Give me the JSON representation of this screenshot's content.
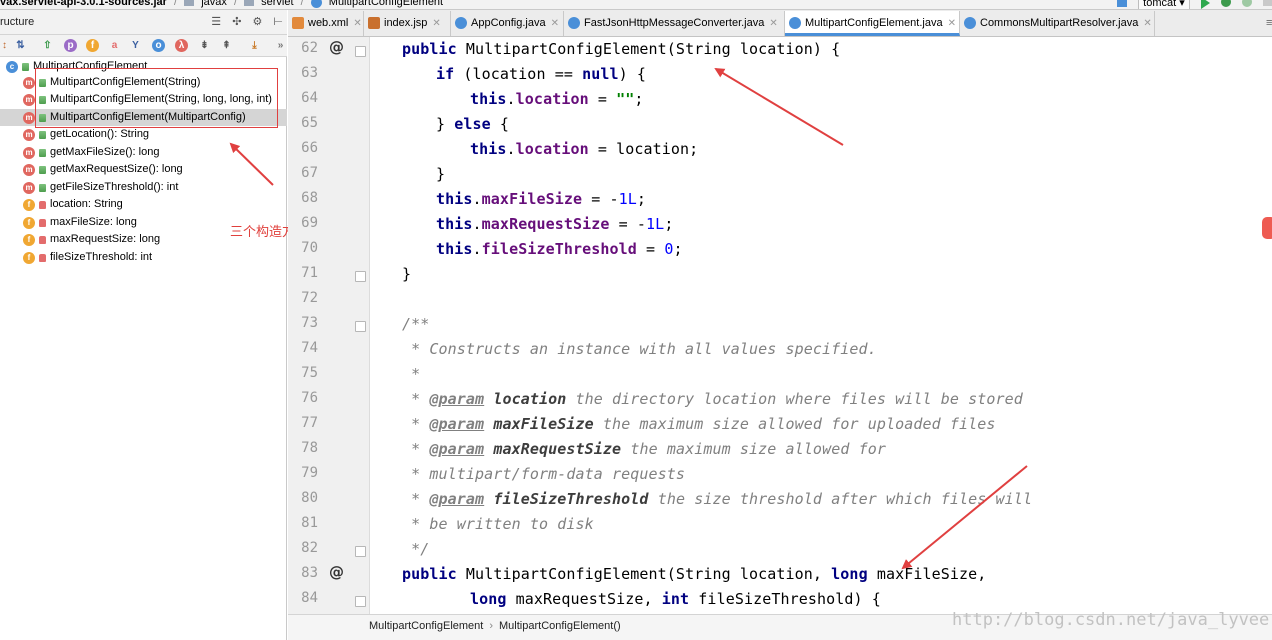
{
  "nav": {
    "crumbs": [
      "vax.servlet-api-3.0.1-sources.jar",
      "javax",
      "servlet",
      "MultipartConfigElement"
    ],
    "run_config": "tomcat"
  },
  "structure": {
    "title": "ructure",
    "root": "MultipartConfigElement",
    "items": [
      {
        "kind": "m",
        "visibility": "public",
        "label": "MultipartConfigElement(String)"
      },
      {
        "kind": "m",
        "visibility": "public",
        "label": "MultipartConfigElement(String, long, long, int)"
      },
      {
        "kind": "m",
        "visibility": "public",
        "label": "MultipartConfigElement(MultipartConfig)"
      },
      {
        "kind": "m",
        "visibility": "public",
        "label": "getLocation(): String"
      },
      {
        "kind": "m",
        "visibility": "public",
        "label": "getMaxFileSize(): long"
      },
      {
        "kind": "m",
        "visibility": "public",
        "label": "getMaxRequestSize(): long"
      },
      {
        "kind": "m",
        "visibility": "public",
        "label": "getFileSizeThreshold(): int"
      },
      {
        "kind": "f",
        "visibility": "private",
        "label": "location: String"
      },
      {
        "kind": "f",
        "visibility": "private",
        "label": "maxFileSize: long"
      },
      {
        "kind": "f",
        "visibility": "private",
        "label": "maxRequestSize: long"
      },
      {
        "kind": "f",
        "visibility": "private",
        "label": "fileSizeThreshold: int"
      }
    ],
    "annotation": "三个构造方法"
  },
  "tabs": [
    {
      "label": "web.xml",
      "icon": "xml-file-icon"
    },
    {
      "label": "index.jsp",
      "icon": "jsp-file-icon"
    },
    {
      "label": "AppConfig.java",
      "icon": "class-icon"
    },
    {
      "label": "FastJsonHttpMessageConverter.java",
      "icon": "class-icon"
    },
    {
      "label": "MultipartConfigElement.java",
      "icon": "class-icon",
      "active": true
    },
    {
      "label": "CommonsMultipartResolver.java",
      "icon": "class-icon"
    }
  ],
  "code": {
    "line_numbers": [
      "62",
      "63",
      "64",
      "65",
      "66",
      "67",
      "68",
      "69",
      "70",
      "71",
      "72",
      "73",
      "74",
      "75",
      "76",
      "77",
      "78",
      "79",
      "80",
      "81",
      "82",
      "83",
      "84"
    ],
    "at_marks": [
      "@",
      "@"
    ],
    "l62": {
      "kw": "public",
      "rest": " MultipartConfigElement(String location) {"
    },
    "l63": {
      "kw1": "if",
      "a": " (location == ",
      "kw2": "null",
      "b": ") {"
    },
    "l64": {
      "kw": "this",
      "dot": ".",
      "fld": "location",
      "eq": " = ",
      "str": "\"\"",
      "end": ";"
    },
    "l65": {
      "a": "} ",
      "kw": "else",
      "b": " {"
    },
    "l66": {
      "kw": "this",
      "dot": ".",
      "fld": "location",
      "rest": " = location;"
    },
    "l67": {
      "text": "}"
    },
    "l68": {
      "kw": "this",
      "dot": ".",
      "fld": "maxFileSize",
      "eq": " = -",
      "num": "1L",
      "end": ";"
    },
    "l69": {
      "kw": "this",
      "dot": ".",
      "fld": "maxRequestSize",
      "eq": " = -",
      "num": "1L",
      "end": ";"
    },
    "l70": {
      "kw": "this",
      "dot": ".",
      "fld": "fileSizeThreshold",
      "eq": " = ",
      "num": "0",
      "end": ";"
    },
    "l71": {
      "text": "}"
    },
    "l73": {
      "text": "/**"
    },
    "l74": {
      "text": " * Constructs an instance with all values specified."
    },
    "l75": {
      "text": " *"
    },
    "l76": {
      "pre": " * ",
      "tag": "@param",
      "sp": " ",
      "name": "location",
      "desc": " the directory location where files will be stored"
    },
    "l77": {
      "pre": " * ",
      "tag": "@param",
      "sp": " ",
      "name": "maxFileSize",
      "desc": " the maximum size allowed for uploaded files"
    },
    "l78": {
      "pre": " * ",
      "tag": "@param",
      "sp": " ",
      "name": "maxRequestSize",
      "desc": " the maximum size allowed for"
    },
    "l79": {
      "text": " * multipart/form-data requests"
    },
    "l80": {
      "pre": " * ",
      "tag": "@param",
      "sp": " ",
      "name": "fileSizeThreshold",
      "desc": " the size threshold after which files will"
    },
    "l81": {
      "text": " * be written to disk"
    },
    "l82": {
      "text": " */"
    },
    "l83": {
      "kw1": "public",
      "a": " MultipartConfigElement(String location, ",
      "kw2": "long",
      "b": " maxFileSize,"
    },
    "l84": {
      "kw1": "long",
      "a": " maxRequestSize, ",
      "kw2": "int",
      "b": " fileSizeThreshold) {"
    }
  },
  "editor_breadcrumb": [
    "MultipartConfigElement",
    "MultipartConfigElement()"
  ],
  "watermark": "http://blog.csdn.net/java_lyvee",
  "colors": {
    "annotation": "#e04040",
    "keyword": "#000080",
    "field": "#660e7a",
    "comment": "#808080",
    "string": "#008000",
    "number": "#0000ff"
  }
}
